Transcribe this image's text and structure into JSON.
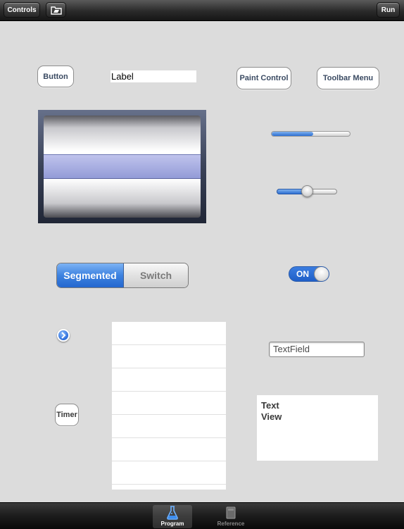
{
  "toolbar": {
    "controls_label": "Controls",
    "folder_icon": "folder-icon",
    "run_label": "Run"
  },
  "controls": {
    "button_label": "Button",
    "label_text": "Label",
    "paint_control_label": "Paint Control",
    "toolbar_menu_label": "Toolbar Menu",
    "progress_value": 0.53,
    "slider_value": 0.5,
    "segmented": [
      "Segmented",
      "Switch"
    ],
    "segmented_selected": 0,
    "switch_label": "ON",
    "switch_on": true,
    "disclosure_icon": "chevron-right-icon",
    "table_rows": 7,
    "textfield_value": "TextField",
    "timer_label": "Timer",
    "textview_lines": [
      "Text",
      "View"
    ]
  },
  "tabbar": {
    "tabs": [
      {
        "label": "Program",
        "icon": "flask-icon",
        "active": true
      },
      {
        "label": "Reference",
        "icon": "book-icon",
        "active": false
      }
    ]
  },
  "colors": {
    "accent_blue": "#2d6fd2",
    "background": "#dcdcdc",
    "bar_dark": "#1c1c1c"
  }
}
